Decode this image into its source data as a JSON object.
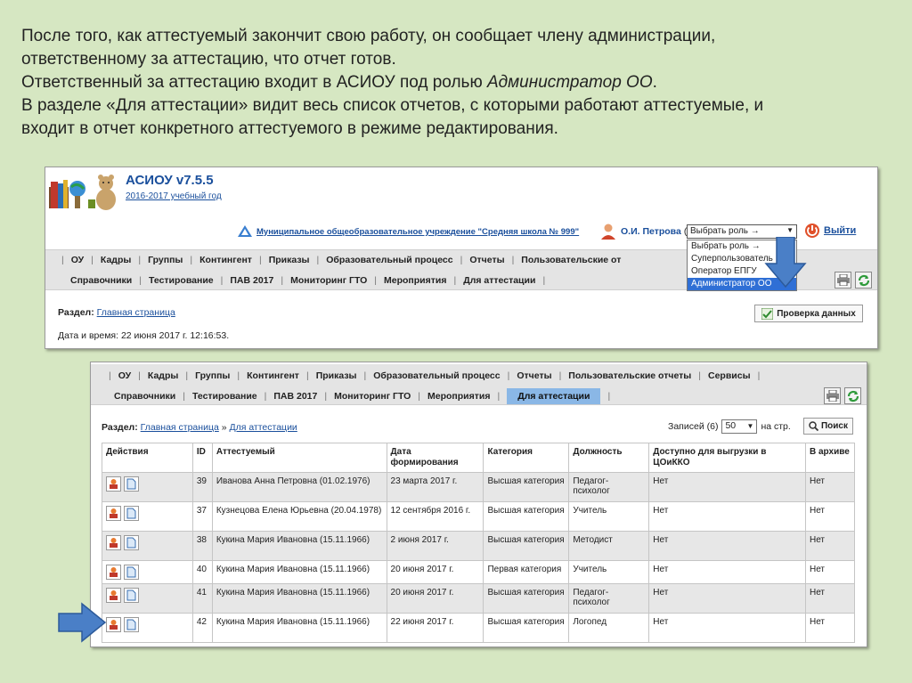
{
  "intro": {
    "line1": "После того, как аттестуемый закончит свою работу, он сообщает члену администрации,",
    "line2": "ответственному за аттестацию, что отчет готов.",
    "line3_pre": "Ответственный за аттестацию входит в АСИОУ под ролью ",
    "line3_role": "Администратор ОО",
    "line3_post": ".",
    "line4": "В разделе «Для аттестации»  видит весь список отчетов, с которыми работают аттестуемые, и",
    "line5": "входит в отчет конкретного аттестуемого в режиме редактирования."
  },
  "app": {
    "title": "АСИОУ v7.5.5",
    "year": "2016-2017 учебный год",
    "org": "Муниципальное общеобразовательное учреждение \"Средняя школа № 999\"",
    "user": "О.И. Петрова",
    "user_paren": "(",
    "role_select": "Выбрать роль →",
    "role_options": [
      "Выбрать роль →",
      "Суперпользователь",
      "Оператор ЕПГУ",
      "Администратор ОО"
    ],
    "exit": "Выйти"
  },
  "menu1": {
    "row1": [
      "ОУ",
      "Кадры",
      "Группы",
      "Контингент",
      "Приказы",
      "Образовательный процесс",
      "Отчеты",
      "Пользовательские от"
    ],
    "row2": [
      "Справочники",
      "Тестирование",
      "ПАВ 2017",
      "Мониторинг ГТО",
      "Мероприятия",
      "Для аттестации"
    ]
  },
  "page1": {
    "section_label": "Раздел:",
    "section_link": "Главная страница",
    "datetime": "Дата и время: 22 июня 2017 г. 12:16:53.",
    "check_button": "Проверка данных"
  },
  "menu2": {
    "row1": [
      "ОУ",
      "Кадры",
      "Группы",
      "Контингент",
      "Приказы",
      "Образовательный процесс",
      "Отчеты",
      "Пользовательские отчеты",
      "Сервисы"
    ],
    "row2": [
      "Справочники",
      "Тестирование",
      "ПАВ 2017",
      "Мониторинг ГТО",
      "Мероприятия",
      "Для аттестации"
    ]
  },
  "page2": {
    "section_label": "Раздел:",
    "crumb_home": "Главная страница",
    "crumb_sep": " » ",
    "crumb_current": "Для аттестации",
    "records_label": "Записей (6)",
    "records_value": "50",
    "records_suffix": "на стр.",
    "search_button": "Поиск"
  },
  "table": {
    "headers": [
      "Действия",
      "ID",
      "Аттестуемый",
      "Дата формирования",
      "Категория",
      "Должность",
      "Доступно для выгрузки в ЦОиККО",
      "В архиве"
    ],
    "rows": [
      {
        "id": "39",
        "name": "Иванова Анна Петровна (01.02.1976)",
        "date": "23 марта 2017 г.",
        "category": "Высшая категория",
        "position": "Педагог-психолог",
        "export": "Нет",
        "archive": "Нет"
      },
      {
        "id": "37",
        "name": "Кузнецова Елена Юрьевна (20.04.1978)",
        "date": "12 сентября 2016 г.",
        "category": "Высшая категория",
        "position": "Учитель",
        "export": "Нет",
        "archive": "Нет"
      },
      {
        "id": "38",
        "name": "Кукина Мария Ивановна (15.11.1966)",
        "date": "2 июня 2017 г.",
        "category": "Высшая категория",
        "position": "Методист",
        "export": "Нет",
        "archive": "Нет"
      },
      {
        "id": "40",
        "name": "Кукина Мария Ивановна (15.11.1966)",
        "date": "20 июня 2017 г.",
        "category": "Первая категория",
        "position": "Учитель",
        "export": "Нет",
        "archive": "Нет"
      },
      {
        "id": "41",
        "name": "Кукина Мария Ивановна (15.11.1966)",
        "date": "20 июня 2017 г.",
        "category": "Высшая категория",
        "position": "Педагог-психолог",
        "export": "Нет",
        "archive": "Нет"
      },
      {
        "id": "42",
        "name": "Кукина Мария Ивановна (15.11.1966)",
        "date": "22 июня 2017 г.",
        "category": "Высшая категория",
        "position": "Логопед",
        "export": "Нет",
        "archive": "Нет"
      }
    ]
  },
  "colors": {
    "background": "#d6e7c2",
    "link": "#1a4f9c",
    "selected_role": "#2f6fd5",
    "active_tab": "#8ab7e6",
    "pointer_arrow": "#4a7fc7"
  },
  "icons": [
    "logo-icon",
    "org-icon",
    "user-icon",
    "exit-icon",
    "print-icon",
    "refresh-icon",
    "check-icon",
    "search-icon",
    "edit-icon",
    "document-icon",
    "pointer-arrow-icon"
  ]
}
